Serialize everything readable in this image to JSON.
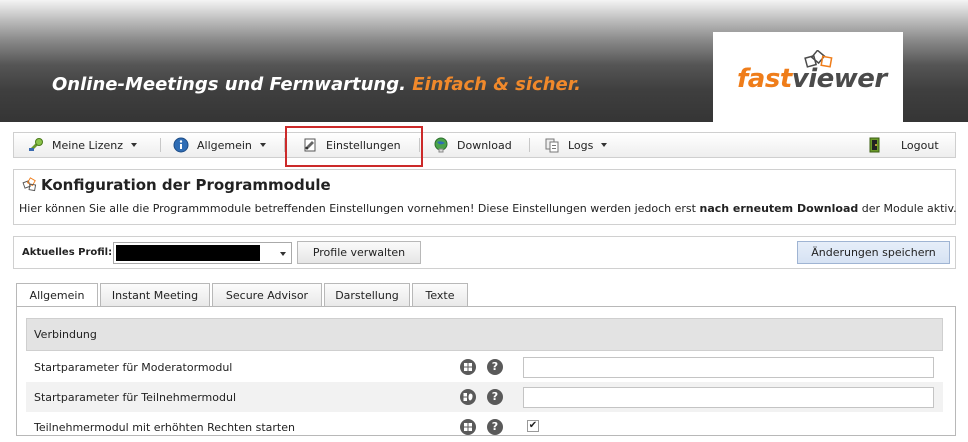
{
  "header": {
    "slogan_main": "Online-Meetings und Fernwartung.",
    "slogan_accent": "Einfach & sicher.",
    "logo_fast": "fast",
    "logo_viewer": "viewer",
    "colors": {
      "accent": "#f0892b",
      "logo_orange": "#ef7d1a",
      "logo_gray": "#4b4b4b"
    }
  },
  "toolbar": {
    "items": [
      {
        "label": "Meine Lizenz",
        "icon": "license-icon"
      },
      {
        "label": "Allgemein",
        "icon": "info-icon"
      },
      {
        "label": "Einstellungen",
        "icon": "settings-icon"
      },
      {
        "label": "Download",
        "icon": "download-globe-icon"
      },
      {
        "label": "Logs",
        "icon": "logs-icon"
      },
      {
        "label": "Logout",
        "icon": "logout-icon"
      }
    ]
  },
  "config": {
    "title": "Konfiguration der Programmodule",
    "desc_pre": "Hier können Sie alle die Programmmodule betreffenden Einstellungen vornehmen! Diese Einstellungen werden jedoch erst ",
    "desc_bold": "nach erneutem Download",
    "desc_post": " der Module aktiv."
  },
  "profile": {
    "label": "Aktuelles Profil:",
    "manage_button": "Profile verwalten",
    "save_button": "Änderungen speichern"
  },
  "tabs": [
    "Allgemein",
    "Instant Meeting",
    "Secure Advisor",
    "Darstellung",
    "Texte"
  ],
  "section": {
    "title": "Verbindung",
    "rows": [
      {
        "label": "Startparameter für Moderatormodul",
        "os_icon": "windows-icon"
      },
      {
        "label": "Startparameter für Teilnehmermodul",
        "os_icon": "windows-mac-icon"
      },
      {
        "label": "Teilnehmermodul mit erhöhten Rechten starten",
        "os_icon": "windows-icon",
        "checked": "✔"
      }
    ],
    "help_glyph": "?"
  }
}
